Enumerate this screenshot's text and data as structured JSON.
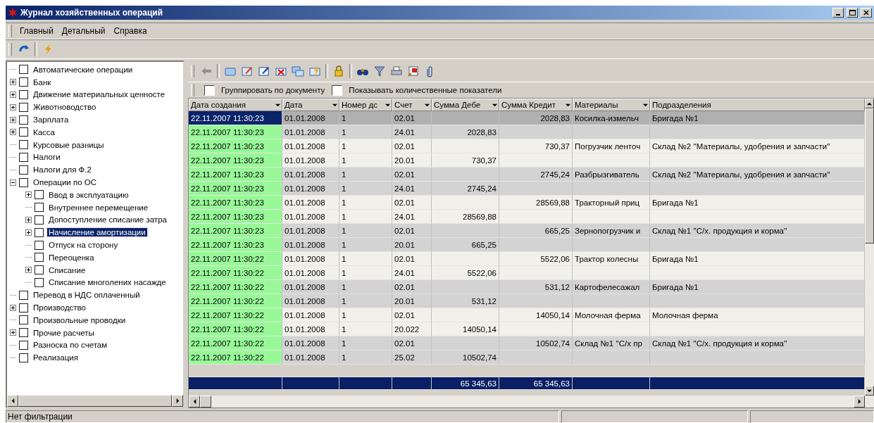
{
  "window": {
    "title": "Журнал хозяйственных операций"
  },
  "menu": [
    "Главный",
    "Детальный",
    "Справка"
  ],
  "tree": [
    {
      "label": "Автоматические операции",
      "checked": false,
      "selected": false
    },
    {
      "label": "Банк",
      "checked": false,
      "selected": false,
      "expanded": false
    },
    {
      "label": "Движение материальных ценносте",
      "checked": false,
      "selected": false,
      "expanded": false
    },
    {
      "label": "Животноводство",
      "checked": false,
      "selected": false,
      "expanded": false
    },
    {
      "label": "Зарплата",
      "checked": false,
      "selected": false,
      "expanded": false
    },
    {
      "label": "Касса",
      "checked": false,
      "selected": false,
      "expanded": false
    },
    {
      "label": "Курсовые разницы",
      "checked": false,
      "selected": false
    },
    {
      "label": "Налоги",
      "checked": false,
      "selected": false
    },
    {
      "label": "Налоги для Ф.2",
      "checked": false,
      "selected": false
    },
    {
      "label": "Операции по ОС",
      "checked": false,
      "selected": false,
      "expanded": true,
      "children": [
        {
          "label": "Ввод в эксплуатацию",
          "checked": false,
          "selected": false,
          "expanded": false
        },
        {
          "label": "Внутреннее перемещение",
          "checked": false,
          "selected": false
        },
        {
          "label": "Допоступление списание затра",
          "checked": false,
          "selected": false,
          "expanded": false
        },
        {
          "label": "Начисление амортизации",
          "checked": false,
          "selected": true,
          "expanded": false
        },
        {
          "label": "Отпуск на сторону",
          "checked": false,
          "selected": false
        },
        {
          "label": "Переоценка",
          "checked": false,
          "selected": false
        },
        {
          "label": "Списание",
          "checked": false,
          "selected": false,
          "expanded": false
        },
        {
          "label": "Списание многолених насажде",
          "checked": false,
          "selected": false
        }
      ]
    },
    {
      "label": "Перевод в НДС оплаченный",
      "checked": false,
      "selected": false
    },
    {
      "label": "Производство",
      "checked": false,
      "selected": false,
      "expanded": false
    },
    {
      "label": "Произвольные проводки",
      "checked": false,
      "selected": false
    },
    {
      "label": "Прочие расчеты",
      "checked": false,
      "selected": false,
      "expanded": false
    },
    {
      "label": "Разноска по счетам",
      "checked": false,
      "selected": false
    },
    {
      "label": "Реализация",
      "checked": false,
      "selected": false
    }
  ],
  "options": [
    {
      "label": "Группировать по документу",
      "checked": false
    },
    {
      "label": "Показывать количественные показатели",
      "checked": false
    }
  ],
  "table": {
    "columns": [
      {
        "label": "Дата создания",
        "dropdown": true
      },
      {
        "label": "Дата",
        "dropdown": true
      },
      {
        "label": "Номер дс",
        "dropdown": true
      },
      {
        "label": "Счет",
        "dropdown": true
      },
      {
        "label": "Сумма Дебе",
        "dropdown": true
      },
      {
        "label": "Сумма Кредит",
        "dropdown": true
      },
      {
        "label": "Материалы",
        "dropdown": true
      },
      {
        "label": "Подразделения",
        "dropdown": false
      }
    ],
    "rows": [
      {
        "selected": true,
        "cells": [
          "22.11.2007 11:30:23",
          "01.01.2008",
          "1",
          "02.01",
          "",
          "2028,83",
          "Косилка-измельч",
          "Бригада №1"
        ]
      },
      {
        "selected": false,
        "cells": [
          "22.11.2007 11:30:23",
          "01.01.2008",
          "1",
          "24.01",
          "2028,83",
          "",
          "",
          ""
        ]
      },
      {
        "selected": false,
        "cells": [
          "22.11.2007 11:30:23",
          "01.01.2008",
          "1",
          "02.01",
          "",
          "730,37",
          "Погрузчик ленточ",
          "Склад №2 ''Материалы, удобрения и запчасти''"
        ]
      },
      {
        "selected": false,
        "cells": [
          "22.11.2007 11:30:23",
          "01.01.2008",
          "1",
          "20.01",
          "730,37",
          "",
          "",
          ""
        ]
      },
      {
        "selected": false,
        "cells": [
          "22.11.2007 11:30:23",
          "01.01.2008",
          "1",
          "02.01",
          "",
          "2745,24",
          "Разбрызгиватель",
          "Склад №2 ''Материалы, удобрения и запчасти''"
        ]
      },
      {
        "selected": false,
        "cells": [
          "22.11.2007 11:30:23",
          "01.01.2008",
          "1",
          "24.01",
          "2745,24",
          "",
          "",
          ""
        ]
      },
      {
        "selected": false,
        "cells": [
          "22.11.2007 11:30:23",
          "01.01.2008",
          "1",
          "02.01",
          "",
          "28569,88",
          "Тракторный приц",
          "Бригада №1"
        ]
      },
      {
        "selected": false,
        "cells": [
          "22.11.2007 11:30:23",
          "01.01.2008",
          "1",
          "24.01",
          "28569,88",
          "",
          "",
          ""
        ]
      },
      {
        "selected": false,
        "cells": [
          "22.11.2007 11:30:23",
          "01.01.2008",
          "1",
          "02.01",
          "",
          "665,25",
          "Зернопогрузчик и",
          "Склад №1 ''С/х. продукция и корма''"
        ]
      },
      {
        "selected": false,
        "cells": [
          "22.11.2007 11:30:23",
          "01.01.2008",
          "1",
          "20.01",
          "665,25",
          "",
          "",
          ""
        ]
      },
      {
        "selected": false,
        "cells": [
          "22.11.2007 11:30:22",
          "01.01.2008",
          "1",
          "02.01",
          "",
          "5522,06",
          "Трактор колесны",
          "Бригада №1"
        ]
      },
      {
        "selected": false,
        "cells": [
          "22.11.2007 11:30:22",
          "01.01.2008",
          "1",
          "24.01",
          "5522,06",
          "",
          "",
          ""
        ]
      },
      {
        "selected": false,
        "cells": [
          "22.11.2007 11:30:22",
          "01.01.2008",
          "1",
          "02.01",
          "",
          "531,12",
          "Картофелесажал",
          "Бригада №1"
        ]
      },
      {
        "selected": false,
        "cells": [
          "22.11.2007 11:30:22",
          "01.01.2008",
          "1",
          "20.01",
          "531,12",
          "",
          "",
          ""
        ]
      },
      {
        "selected": false,
        "cells": [
          "22.11.2007 11:30:22",
          "01.01.2008",
          "1",
          "02.01",
          "",
          "14050,14",
          "Молочная ферма",
          "Молочная ферма"
        ]
      },
      {
        "selected": false,
        "cells": [
          "22.11.2007 11:30:22",
          "01.01.2008",
          "1",
          "20.022",
          "14050,14",
          "",
          "",
          ""
        ]
      },
      {
        "selected": false,
        "cells": [
          "22.11.2007 11:30:22",
          "01.01.2008",
          "1",
          "02.01",
          "",
          "10502,74",
          "Склад №1 ''С/х пр",
          "Склад №1 ''С/х. продукция и корма''"
        ]
      },
      {
        "selected": false,
        "cells": [
          "22.11.2007 11:30:22",
          "01.01.2008",
          "1",
          "25.02",
          "10502,74",
          "",
          "",
          ""
        ]
      }
    ],
    "totals": {
      "debit": "65 345,63",
      "credit": "65 345,63"
    }
  },
  "status_bar": [
    "Нет фильтрации"
  ]
}
